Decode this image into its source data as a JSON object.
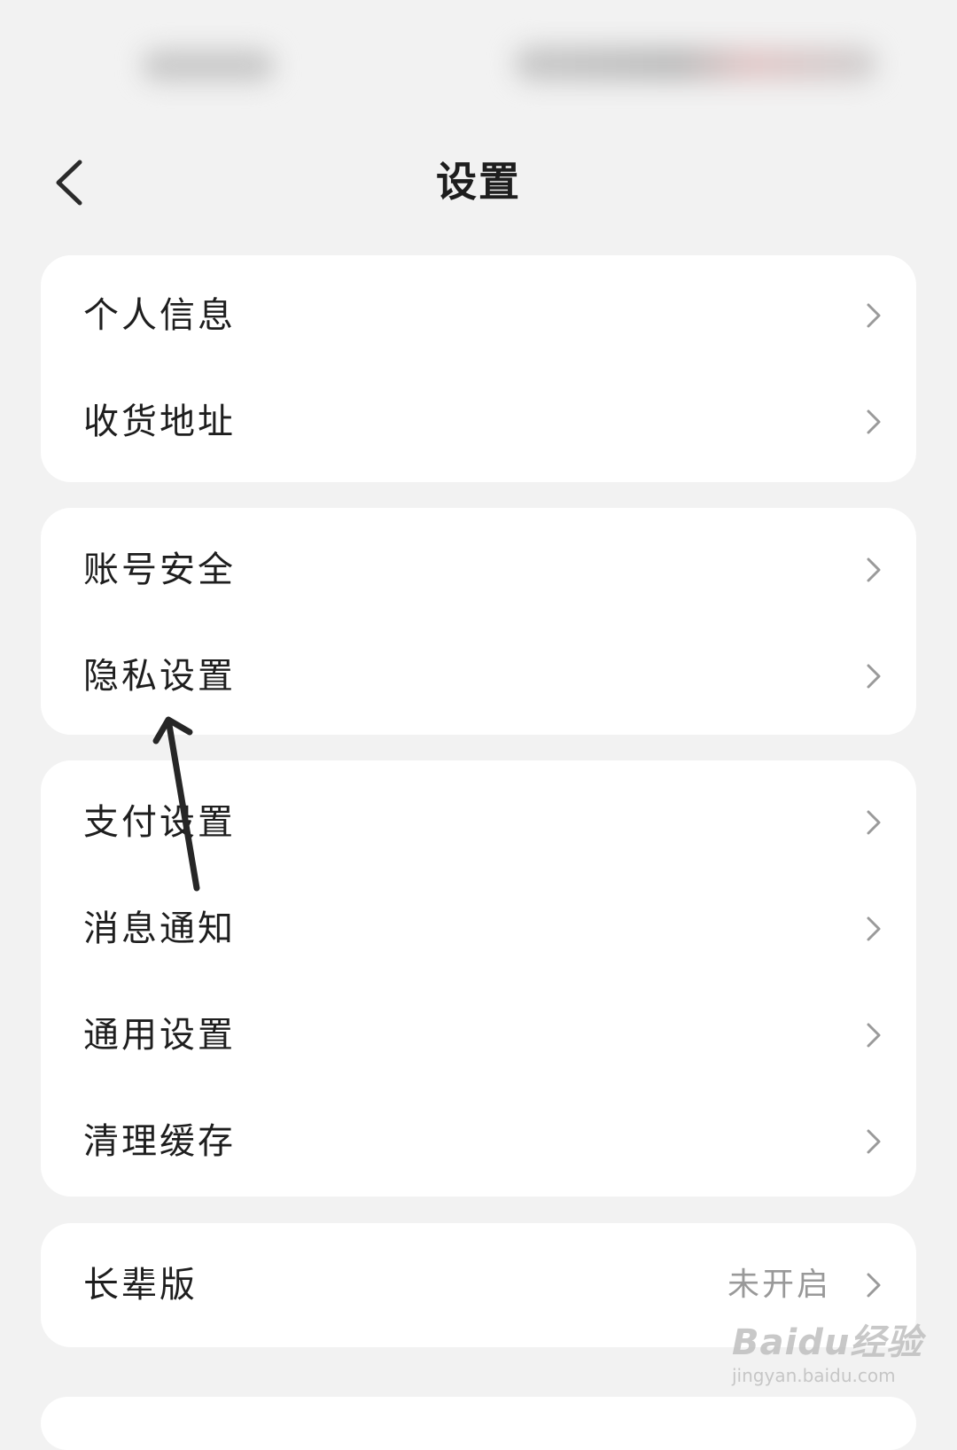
{
  "header": {
    "title": "设置",
    "back_icon": "chevron-left-icon"
  },
  "groups": [
    {
      "items": [
        {
          "label": "个人信息"
        },
        {
          "label": "收货地址"
        }
      ]
    },
    {
      "items": [
        {
          "label": "账号安全"
        },
        {
          "label": "隐私设置"
        }
      ]
    },
    {
      "items": [
        {
          "label": "支付设置"
        },
        {
          "label": "消息通知"
        },
        {
          "label": "通用设置"
        },
        {
          "label": "清理缓存"
        }
      ]
    },
    {
      "items": [
        {
          "label": "长辈版",
          "value": "未开启"
        }
      ]
    }
  ],
  "watermark": {
    "brand": "Baidu经验",
    "url": "jingyan.baidu.com"
  }
}
